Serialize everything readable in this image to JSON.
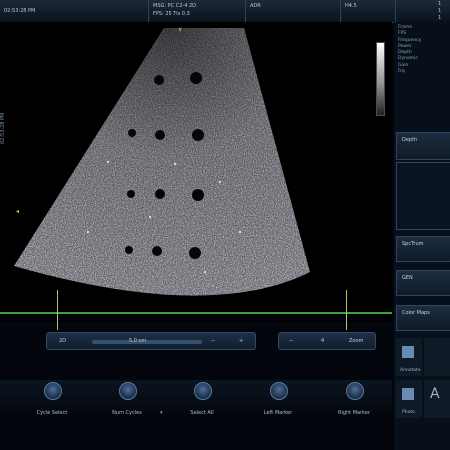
{
  "topbar": {
    "time": "02:53:28 PM",
    "probe_line1": "MSG: PC  C2-4  2D",
    "probe_line2": "FPS: 25  Tis 0.3",
    "app": "ADR",
    "freq": "H4.5",
    "right_line1": "1",
    "right_line2": "1",
    "right_line3": "1"
  },
  "left_timestamp": "02:53:28 PM",
  "params": [
    "Frame",
    "FPS",
    "Frequency",
    "Power",
    "Depth",
    "Dynamic",
    "Gain",
    "Frq"
  ],
  "rp_depth": "Depth",
  "rp_spctrum": "SpcTrum",
  "rp_gen": "GEN",
  "rp_color": "Color Maps",
  "depth_ctrl": {
    "mode": "2D",
    "value": "5.0 cm",
    "minus": "−",
    "plus": "+"
  },
  "zoom_ctrl": {
    "minus": "−",
    "value": "4",
    "label": "Zoom"
  },
  "softkeys": [
    {
      "label": "Cycle Select"
    },
    {
      "label": "Num Cycles"
    },
    {
      "label": "Select All"
    },
    {
      "label": "Left Marker"
    },
    {
      "label": "Right Marker"
    }
  ],
  "br": {
    "tile1": "Annotate",
    "tile2": "Photo",
    "text_glyph": "A"
  },
  "colors": {
    "accent": "#2f4a66",
    "timeline": "#3aa23a",
    "background": "#02060c"
  }
}
